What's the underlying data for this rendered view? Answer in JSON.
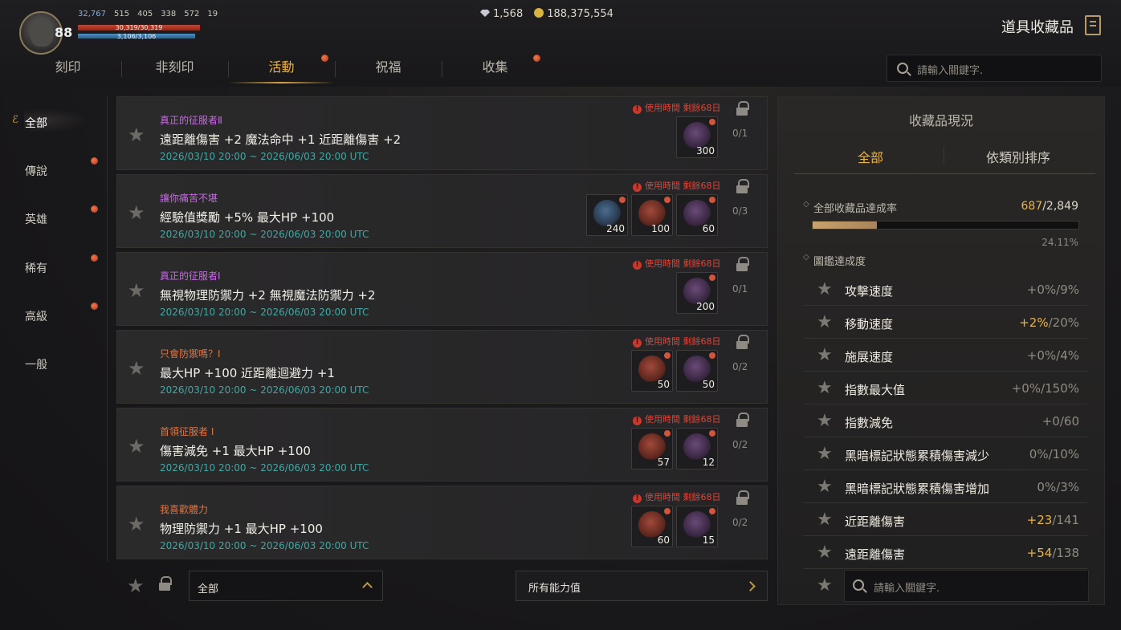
{
  "player": {
    "level": "88",
    "stat1": "32,767",
    "stat2": "515",
    "stat3": "405",
    "stat4": "338",
    "stat5": "572",
    "stat6": "19",
    "hp": "30,319/30,319",
    "mp": "3,106/3,106"
  },
  "currency": {
    "gems": "1,568",
    "gold": "188,375,554"
  },
  "header": {
    "title": "道具收藏品"
  },
  "tabs": [
    {
      "label": "刻印",
      "badge": false
    },
    {
      "label": "非刻印",
      "badge": false
    },
    {
      "label": "活動",
      "badge": true,
      "active": true
    },
    {
      "label": "祝福",
      "badge": false
    },
    {
      "label": "收集",
      "badge": true
    }
  ],
  "search": {
    "placeholder": "請輸入關鍵字."
  },
  "sidebar": {
    "items": [
      {
        "label": "全部",
        "active": true,
        "badge": false
      },
      {
        "label": "傳說",
        "badge": true
      },
      {
        "label": "英雄",
        "badge": true
      },
      {
        "label": "稀有",
        "badge": true
      },
      {
        "label": "高級",
        "badge": true
      },
      {
        "label": "一般",
        "badge": false
      }
    ]
  },
  "list": [
    {
      "name": "真正的征服者Ⅱ",
      "name_color": "#c46be0",
      "desc": "遠距離傷害 +2 魔法命中 +1 近距離傷害 +2",
      "date": "2026/03/10 20:00 ~ 2026/06/03 20:00 UTC",
      "warn": "使用時間 剩餘68日",
      "progress": "0/1",
      "items": [
        {
          "type": "purple",
          "count": "300"
        }
      ]
    },
    {
      "name": "讓你痛苦不堪",
      "name_color": "#c46be0",
      "desc": "經驗值獎勵 +5% 最大HP +100",
      "date": "2026/03/10 20:00 ~ 2026/06/03 20:00 UTC",
      "warn": "使用時間 剩餘68日",
      "progress": "0/3",
      "items": [
        {
          "type": "blue",
          "count": "240"
        },
        {
          "type": "red",
          "count": "100"
        },
        {
          "type": "purple",
          "count": "60"
        }
      ]
    },
    {
      "name": "真正的征服者Ⅰ",
      "name_color": "#c46be0",
      "desc": "無視物理防禦力 +2 無視魔法防禦力 +2",
      "date": "2026/03/10 20:00 ~ 2026/06/03 20:00 UTC",
      "warn": "使用時間 剩餘68日",
      "progress": "0/1",
      "items": [
        {
          "type": "purple",
          "count": "200"
        }
      ]
    },
    {
      "name": "只會防禦嗎？Ⅰ",
      "name_color": "#e07440",
      "desc": "最大HP +100 近距離迴避力 +1",
      "date": "2026/03/10 20:00 ~ 2026/06/03 20:00 UTC",
      "warn": "使用時間 剩餘68日",
      "progress": "0/2",
      "items": [
        {
          "type": "red",
          "count": "50"
        },
        {
          "type": "purple",
          "count": "50"
        }
      ]
    },
    {
      "name": "首領征服者 Ⅰ",
      "name_color": "#e07440",
      "desc": "傷害減免 +1 最大HP +100",
      "date": "2026/03/10 20:00 ~ 2026/06/03 20:00 UTC",
      "warn": "使用時間 剩餘68日",
      "progress": "0/2",
      "items": [
        {
          "type": "red",
          "count": "57"
        },
        {
          "type": "purple",
          "count": "12"
        }
      ]
    },
    {
      "name": "我喜歡體力",
      "name_color": "#e07440",
      "desc": "物理防禦力 +1 最大HP +100",
      "date": "2026/03/10 20:00 ~ 2026/06/03 20:00 UTC",
      "warn": "使用時間 剩餘68日",
      "progress": "0/2",
      "items": [
        {
          "type": "red",
          "count": "60"
        },
        {
          "type": "purple",
          "count": "15"
        }
      ]
    }
  ],
  "bottom": {
    "filter_value": "全部",
    "stat_filter": "所有能力值"
  },
  "panel": {
    "title": "收藏品現況",
    "tab_all": "全部",
    "tab_sort": "依類別排序",
    "rate_label": "全部收藏品達成率",
    "rate_current": "687",
    "rate_total": "/2,849",
    "rate_percent": "24.11%",
    "rate_fraction": 0.2411,
    "dex_label": "圖鑑達成度",
    "stats": [
      {
        "label": "攻擊速度",
        "value": "+0%",
        "max": "/9%",
        "highlight": false
      },
      {
        "label": "移動速度",
        "value": "+2%",
        "max": "/20%",
        "highlight": true
      },
      {
        "label": "施展速度",
        "value": "+0%",
        "max": "/4%",
        "highlight": false
      },
      {
        "label": "指數最大值",
        "value": "+0%",
        "max": "/150%",
        "highlight": false
      },
      {
        "label": "指數減免",
        "value": "+0",
        "max": "/60",
        "highlight": false
      },
      {
        "label": "黑暗標記狀態累積傷害減少",
        "value": "0%",
        "max": "/10%",
        "highlight": false
      },
      {
        "label": "黑暗標記狀態累積傷害增加",
        "value": "0%",
        "max": "/3%",
        "highlight": false
      },
      {
        "label": "近距離傷害",
        "value": "+23",
        "max": "/141",
        "highlight": true
      },
      {
        "label": "遠距離傷害",
        "value": "+54",
        "max": "/138",
        "highlight": true
      }
    ],
    "search_placeholder": "請輸入關鍵字."
  }
}
